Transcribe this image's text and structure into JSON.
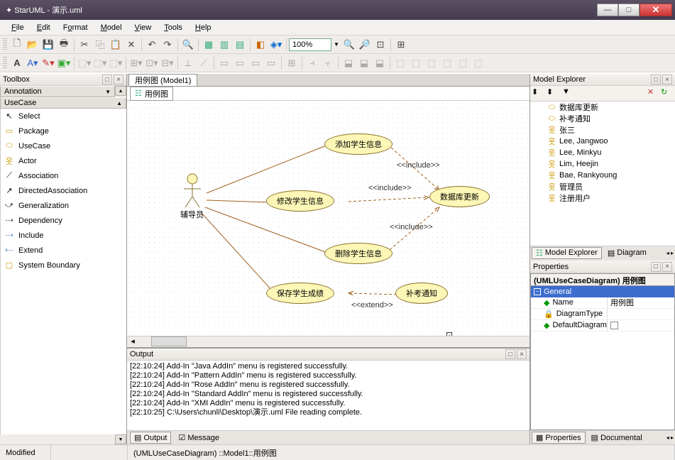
{
  "window": {
    "title": "StarUML - 演示.uml"
  },
  "menu": {
    "items": [
      "File",
      "Edit",
      "Format",
      "Model",
      "View",
      "Tools",
      "Help"
    ]
  },
  "toolbar": {
    "zoom": "100%"
  },
  "toolbox": {
    "title": "Toolbox",
    "sections": {
      "annotation": "Annotation",
      "usecase": "UseCase"
    },
    "items": [
      "Select",
      "Package",
      "UseCase",
      "Actor",
      "Association",
      "DirectedAssociation",
      "Generalization",
      "Dependency",
      "Include",
      "Extend",
      "System Boundary"
    ]
  },
  "diagram": {
    "tab": "用例图 (Model1)",
    "name": "用例图",
    "actor": "辅导员",
    "usecases": {
      "add": "添加学生信息",
      "modify": "修改学生信息",
      "delete": "删除学生信息",
      "save": "保存学生成绩",
      "dbupdate": "数据库更新",
      "retest": "补考通知"
    },
    "labels": {
      "include": "<<include>>",
      "extend": "<<extend>>"
    }
  },
  "explorer": {
    "title": "Model Explorer",
    "items": [
      {
        "icon": "usecase",
        "label": "数据库更新"
      },
      {
        "icon": "usecase",
        "label": "补考通知"
      },
      {
        "icon": "actor",
        "label": "张三"
      },
      {
        "icon": "actor",
        "label": "Lee, Jangwoo"
      },
      {
        "icon": "actor",
        "label": "Lee, Minkyu"
      },
      {
        "icon": "actor",
        "label": "Lim, Heejin"
      },
      {
        "icon": "actor",
        "label": "Bae, Rankyoung"
      },
      {
        "icon": "actor",
        "label": "管理员"
      },
      {
        "icon": "actor",
        "label": "注册用户"
      }
    ],
    "tabs": {
      "model": "Model Explorer",
      "diagram": "Diagram"
    }
  },
  "properties": {
    "title": "Properties",
    "object": "(UMLUseCaseDiagram) 用例图",
    "group": "General",
    "rows": {
      "name_label": "Name",
      "name_value": "用例图",
      "type_label": "DiagramType",
      "type_value": "",
      "default_label": "DefaultDiagram",
      "default_value": ""
    },
    "tabs": {
      "prop": "Properties",
      "doc": "Documental"
    }
  },
  "output": {
    "title": "Output",
    "lines": [
      "[22:10:24]  Add-In \"Java AddIn\" menu is registered successfully.",
      "[22:10:24]  Add-In \"Pattern AddIn\" menu is registered successfully.",
      "[22:10:24]  Add-In \"Rose AddIn\" menu is registered successfully.",
      "[22:10:24]  Add-In \"Standard AddIn\" menu is registered successfully.",
      "[22:10:24]  Add-In \"XMI AddIn\" menu is registered successfully.",
      "[22:10:25]  C:\\Users\\chunli\\Desktop\\演示.uml File reading complete."
    ],
    "tabs": {
      "output": "Output",
      "message": "Message"
    }
  },
  "status": {
    "modified": "Modified",
    "path": "(UMLUseCaseDiagram) ::Model1::用例图"
  }
}
